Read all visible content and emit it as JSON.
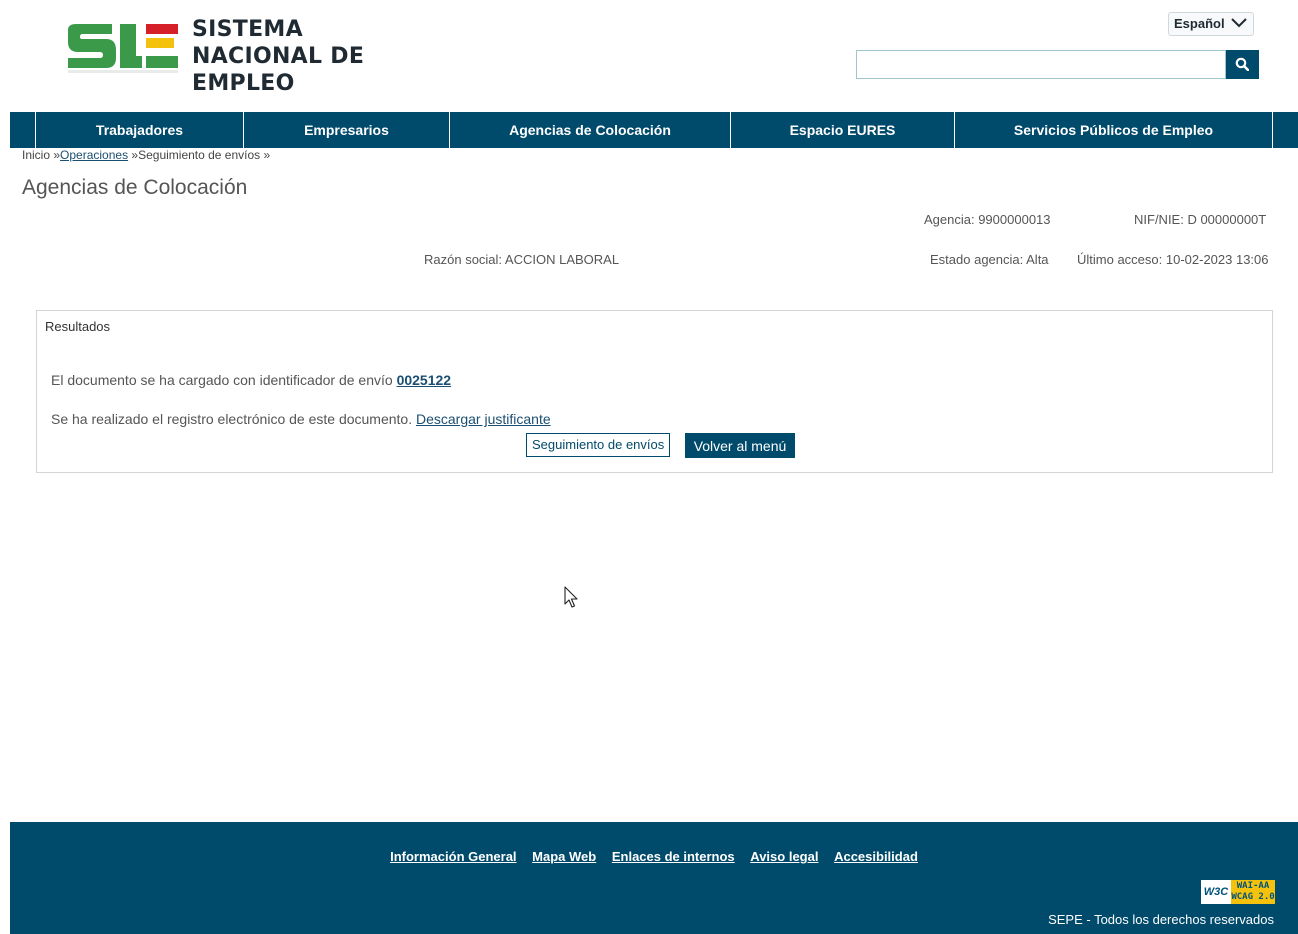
{
  "header": {
    "logo_line1": "SISTEMA",
    "logo_line2": "NACIONAL DE EMPLEO",
    "language": "Español",
    "search_placeholder": ""
  },
  "nav": {
    "items": [
      {
        "label": "Trabajadores"
      },
      {
        "label": "Empresarios"
      },
      {
        "label": "Agencias de Colocación"
      },
      {
        "label": "Espacio EURES"
      },
      {
        "label": "Servicios Públicos de Empleo"
      }
    ]
  },
  "breadcrumb": {
    "home": "Inicio »",
    "link": "Operaciones",
    "current": " »Seguimiento de envíos »"
  },
  "page": {
    "title": "Agencias de Colocación",
    "agencia": "Agencia: 9900000013",
    "nif": "NIF/NIE: D 00000000T",
    "razon_social": "Razón social: ACCION LABORAL",
    "estado": "Estado agencia: Alta",
    "ultimo_acceso": "Último acceso: 10-02-2023 13:06"
  },
  "results": {
    "title": "Resultados",
    "line1_text": "El documento se ha cargado con identificador de envío ",
    "line1_id": "0025122",
    "line2_text": "Se ha realizado el registro electrónico de este documento. ",
    "line2_link": "Descargar justificante",
    "btn_seguimiento": "Seguimiento de envíos",
    "btn_volver": "Volver al menú"
  },
  "footer": {
    "links": [
      "Información General",
      "Mapa Web",
      "Enlaces de internos",
      "Aviso legal",
      "Accesibilidad"
    ],
    "w3c": "W3C",
    "badge_line1": "WAI-AA",
    "badge_line2": "WCAG 2.0",
    "copyright": "SEPE - Todos los derechos reservados"
  },
  "colors": {
    "primary": "#004a6b",
    "logo_green": "#3a9a4a",
    "logo_red": "#d5202a",
    "logo_yellow": "#f4c20d"
  },
  "icons": [
    "sne-logo-icon",
    "chevron-down-icon",
    "search-icon",
    "mouse-pointer-icon"
  ]
}
